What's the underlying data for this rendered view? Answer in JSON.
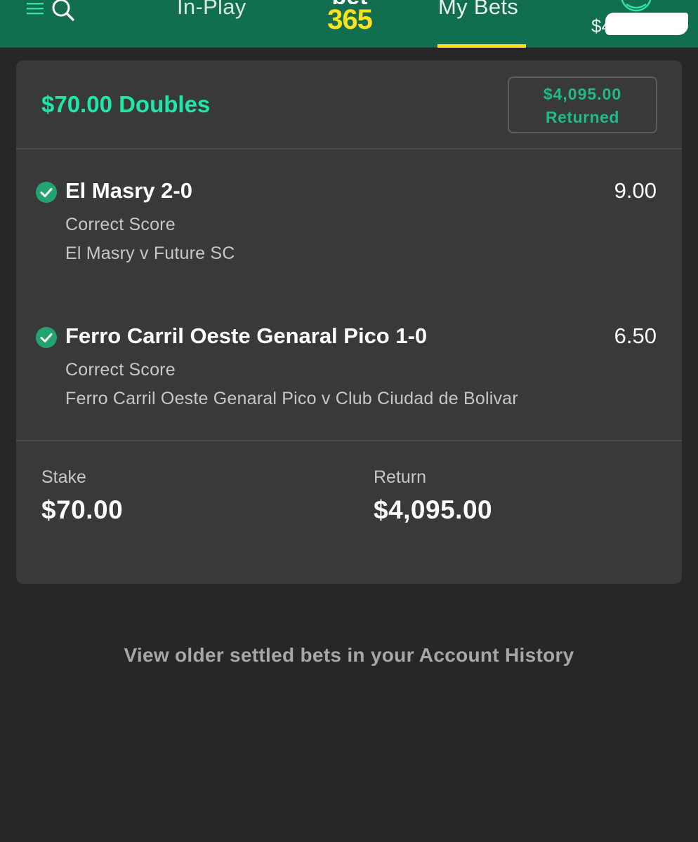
{
  "header": {
    "nav": {
      "inplay_label": "In-Play",
      "mybets_label": "My Bets"
    },
    "logo": {
      "top": "bet",
      "bottom": "365"
    },
    "balance": "$4"
  },
  "bet": {
    "title": "$70.00 Doubles",
    "returned_amount": "$4,095.00",
    "returned_label": "Returned",
    "selections": [
      {
        "name": "El Masry 2-0",
        "odds": "9.00",
        "market": "Correct Score",
        "event": "El Masry v Future SC",
        "status": "won"
      },
      {
        "name": "Ferro Carril Oeste Genaral Pico 1-0",
        "odds": "6.50",
        "market": "Correct Score",
        "event": "Ferro Carril Oeste Genaral Pico v Club Ciudad de Bolivar",
        "status": "won"
      }
    ],
    "stake_label": "Stake",
    "stake_value": "$70.00",
    "return_label": "Return",
    "return_value": "$4,095.00"
  },
  "footer": {
    "history_link": "View older settled bets in your Account History"
  },
  "colors": {
    "header_green": "#126e51",
    "accent_green": "#1ee7a9",
    "logo_yellow": "#ffdf1b",
    "check_green": "#23a36f"
  }
}
